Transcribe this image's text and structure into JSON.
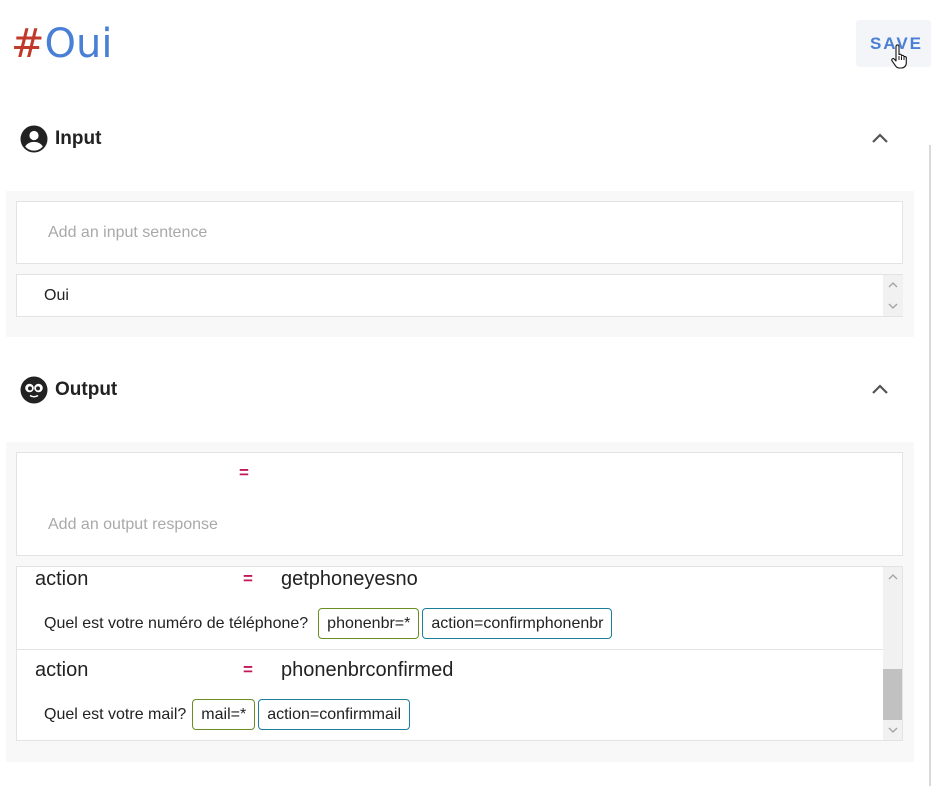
{
  "header": {
    "title_hash": "#",
    "title_name": "Oui",
    "save_label": "SAVE"
  },
  "input_section": {
    "title": "Input",
    "add_placeholder": "Add an input sentence",
    "sentences": [
      "Oui"
    ]
  },
  "output_section": {
    "title": "Output",
    "new_equals": "=",
    "add_placeholder": "Add an output response",
    "responses": [
      {
        "variable": "action",
        "equals": "=",
        "value": "getphoneyesno",
        "sentence": "Quel est votre numéro de téléphone?",
        "tags": [
          "phonenbr=*",
          "action=confirmphonenbr"
        ]
      },
      {
        "variable": "action",
        "equals": "=",
        "value": "phonenbrconfirmed",
        "sentence": "Quel est votre mail?",
        "tags": [
          "mail=*",
          "action=confirmmail"
        ]
      }
    ]
  },
  "colors": {
    "accent": "#4a7fd6",
    "hash": "#c0392b",
    "equals": "#c2185b",
    "tag_green": "#6b8e23",
    "tag_teal": "#1a7f9c"
  },
  "icons": {
    "input": "account-circle-icon",
    "output": "bot-face-icon",
    "collapse": "chevron-up-icon",
    "cursor": "hand-pointer-icon"
  }
}
